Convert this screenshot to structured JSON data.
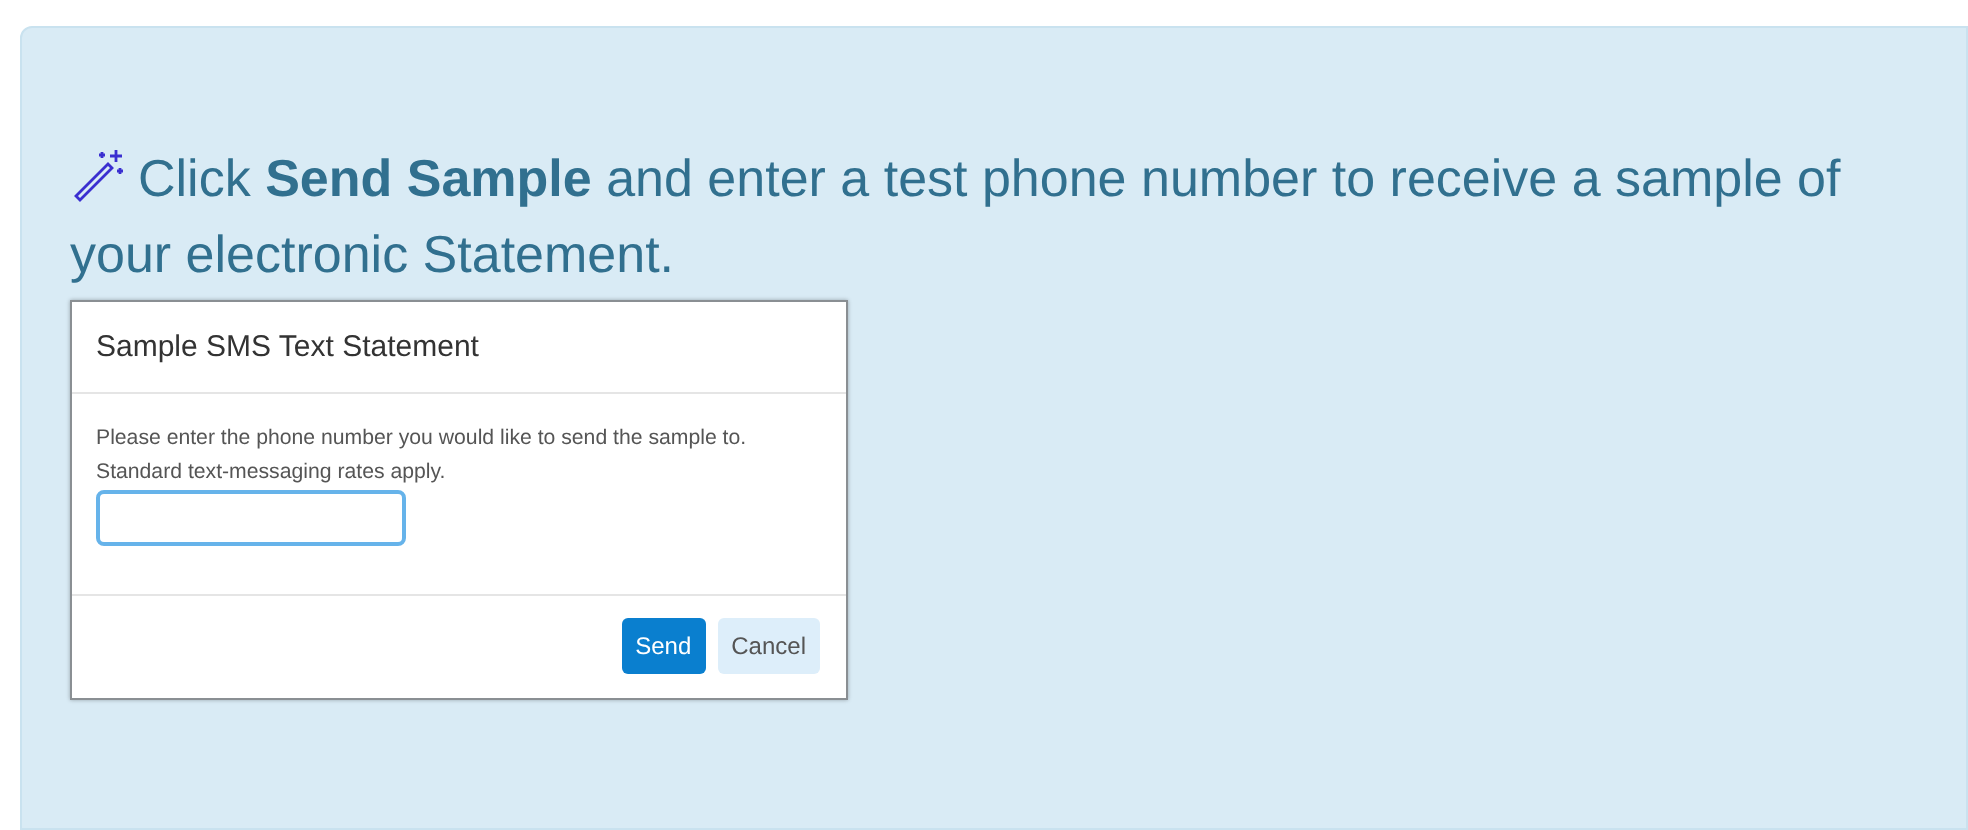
{
  "tip": {
    "text": "Click **Send Sample** and enter a test phone number to receive a sample of your electronic Statement."
  },
  "dialog": {
    "title": "Sample SMS Text Statement",
    "message": "Please enter the phone number you would like to send the sample to. Standard text-messaging rates apply.",
    "phone_field": {
      "focused": true
    },
    "buttons": [
      {
        "label": "Send",
        "kind": "primary"
      },
      {
        "label": "Cancel",
        "kind": "secondary"
      }
    ]
  }
}
